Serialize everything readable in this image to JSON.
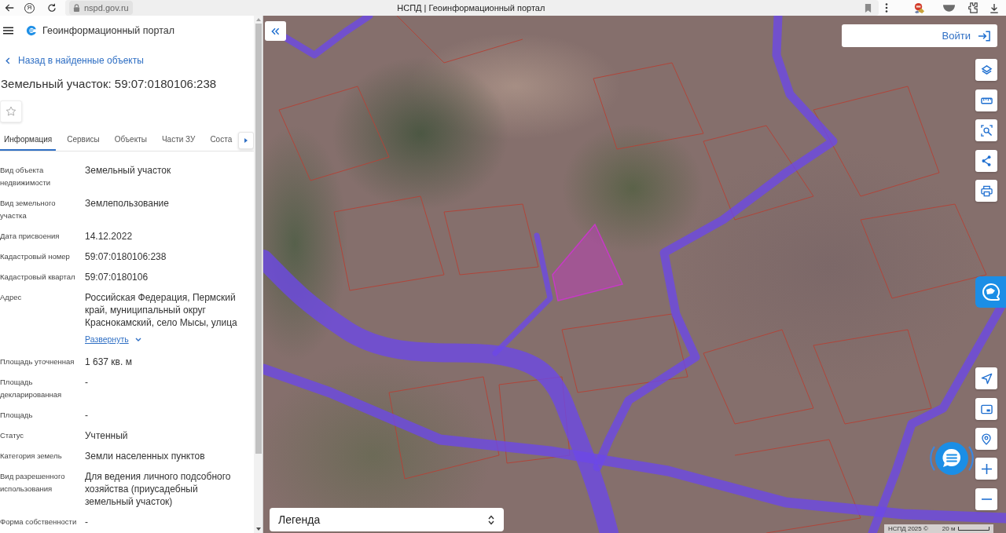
{
  "browser": {
    "brand_glyph": "Я",
    "url": "nspd.gov.ru",
    "title": "НСПД | Геоинформационный портал"
  },
  "sidebar": {
    "app_title": "Геоинформационный портал",
    "back_link": "Назад в найденные объекты",
    "heading": "Земельный участок: 59:07:0180106:238",
    "tabs": [
      {
        "label": "Информация",
        "selected": true
      },
      {
        "label": "Сервисы",
        "selected": false
      },
      {
        "label": "Объекты",
        "selected": false
      },
      {
        "label": "Части ЗУ",
        "selected": false
      },
      {
        "label": "Соста",
        "selected": false
      }
    ],
    "properties": [
      {
        "label": "Вид объекта недвижимости",
        "value": "Земельный участок"
      },
      {
        "label": "Вид земельного участка",
        "value": "Землепользование"
      },
      {
        "label": "Дата присвоения",
        "value": "14.12.2022"
      },
      {
        "label": "Кадастровый номер",
        "value": "59:07:0180106:238"
      },
      {
        "label": "Кадастровый квартал",
        "value": "59:07:0180106"
      },
      {
        "label": "Адрес",
        "value": "Российская Федерация, Пермский край, муниципальный округ Краснокамский, село Мысы, улица",
        "expand_link": "Развернуть"
      },
      {
        "label": "Площадь уточненная",
        "value": "1 637 кв. м"
      },
      {
        "label": "Площадь декларированная",
        "value": "-"
      },
      {
        "label": "Площадь",
        "value": "-"
      },
      {
        "label": "Статус",
        "value": "Учтенный"
      },
      {
        "label": "Категория земель",
        "value": "Земли населенных пунктов"
      },
      {
        "label": "Вид разрешенного использования",
        "value": "Для ведения личного подсобного хозяйства (приусадебный земельный участок)"
      },
      {
        "label": "Форма собственности",
        "value": "-"
      }
    ]
  },
  "map": {
    "login_button": "Войти",
    "legend": "Легенда",
    "attribution": "НСПД 2025 ©",
    "scale": "20 м"
  }
}
